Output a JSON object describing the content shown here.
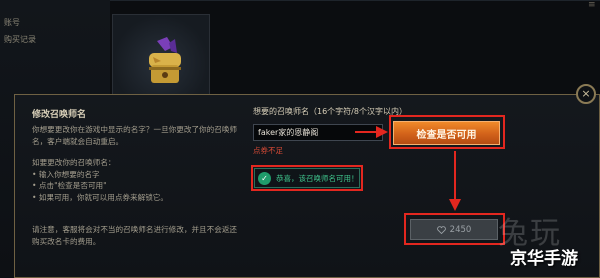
{
  "background": {
    "nav_items": [
      "账号",
      "购买记录"
    ]
  },
  "dialog": {
    "title": "修改召唤师名",
    "intro": "你想要更改你在游戏中显示的名字？一旦你更改了你的召唤师名，客户端就会自动重启。",
    "steps_heading": "如要更改你的召唤师名：",
    "steps": [
      "输入你想要的名字",
      "点击\"检查是否可用\"",
      "如果可用，你就可以用点券来解锁它。"
    ],
    "notice": "请注意，客服将会对不当的召唤师名进行修改，并且不会返还购买改名卡的费用。",
    "field_label": "想要的召唤师名（16个字符/8个汉字以内）",
    "name_value": "faker家的恩静阁",
    "cost_note": "点券不足",
    "check_button": "检查是否可用",
    "success_message": "恭喜，该召唤师名可用！",
    "price": "2450",
    "close_label": "×"
  },
  "icons": {
    "close": "close-icon",
    "success": "checkmark-icon",
    "price": "heart-icon"
  },
  "colors": {
    "accent_orange": "#e07426",
    "highlight_red": "#e3271f",
    "success_green": "#3fc38c",
    "error_red": "#d84a36",
    "gold_border": "#6f6143"
  },
  "watermark": {
    "big": "兔玩",
    "small": "京华手游"
  }
}
